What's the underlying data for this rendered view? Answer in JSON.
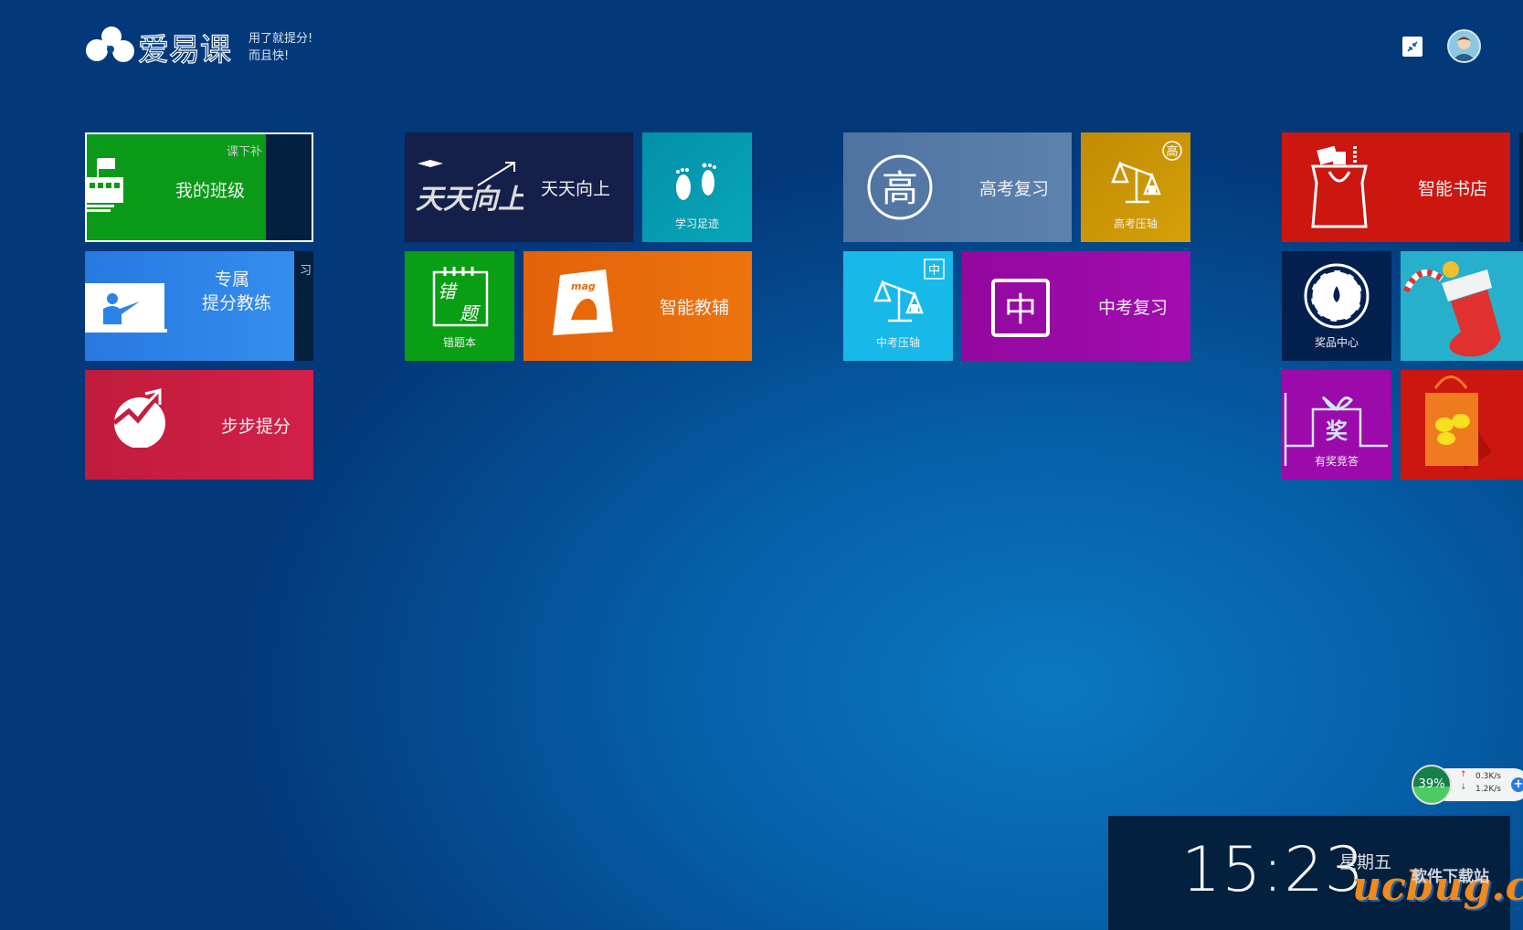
{
  "header": {
    "brand": "爱易课",
    "slogan_line1": "用了就提分!",
    "slogan_line2": "而且快!"
  },
  "tiles": {
    "my_class": {
      "label": "我的班级",
      "side": "课下补"
    },
    "coach": {
      "label_line1": "专属",
      "label_line2": "提分教练",
      "side": "习"
    },
    "step": {
      "label": "步步提分"
    },
    "ttxs": {
      "label": "天天向上",
      "logo_text": "天天向上"
    },
    "footprint": {
      "label": "学习足迹"
    },
    "mistakes": {
      "label": "错题本",
      "icon_text1": "错",
      "icon_text2": "题"
    },
    "tutor": {
      "label": "智能教辅",
      "icon_text": "mag"
    },
    "gaokao": {
      "label": "高考复习",
      "icon_text": "高"
    },
    "gaokao_axis": {
      "label": "高考压轴",
      "badge": "高"
    },
    "zhongkao_axis": {
      "label": "中考压轴",
      "badge": "中"
    },
    "zhongkao": {
      "label": "中考复习",
      "icon_text": "中"
    },
    "bookstore": {
      "label": "智能书店"
    },
    "prize": {
      "label": "奖品中心"
    },
    "quiz": {
      "label": "有奖竞答",
      "icon_text": "奖"
    }
  },
  "colors": {
    "green": "#0a9a17",
    "navy": "#141f4a",
    "teal": "#0497ac",
    "orange": "#e8690a",
    "slate": "#5479a3",
    "gold": "#cc9806",
    "cyan": "#17b9e8",
    "purple": "#9c0aab",
    "red": "#cc1610",
    "crimson": "#c41e3e",
    "blue": "#2b82e8"
  },
  "network": {
    "percent": "39%",
    "up": "0.3K/s",
    "down": "1.2K/s"
  },
  "clock": {
    "time": "15:23",
    "weekday": "星期五"
  },
  "watermark": {
    "text": "ucbug.cc",
    "sub": "软件下载站"
  }
}
